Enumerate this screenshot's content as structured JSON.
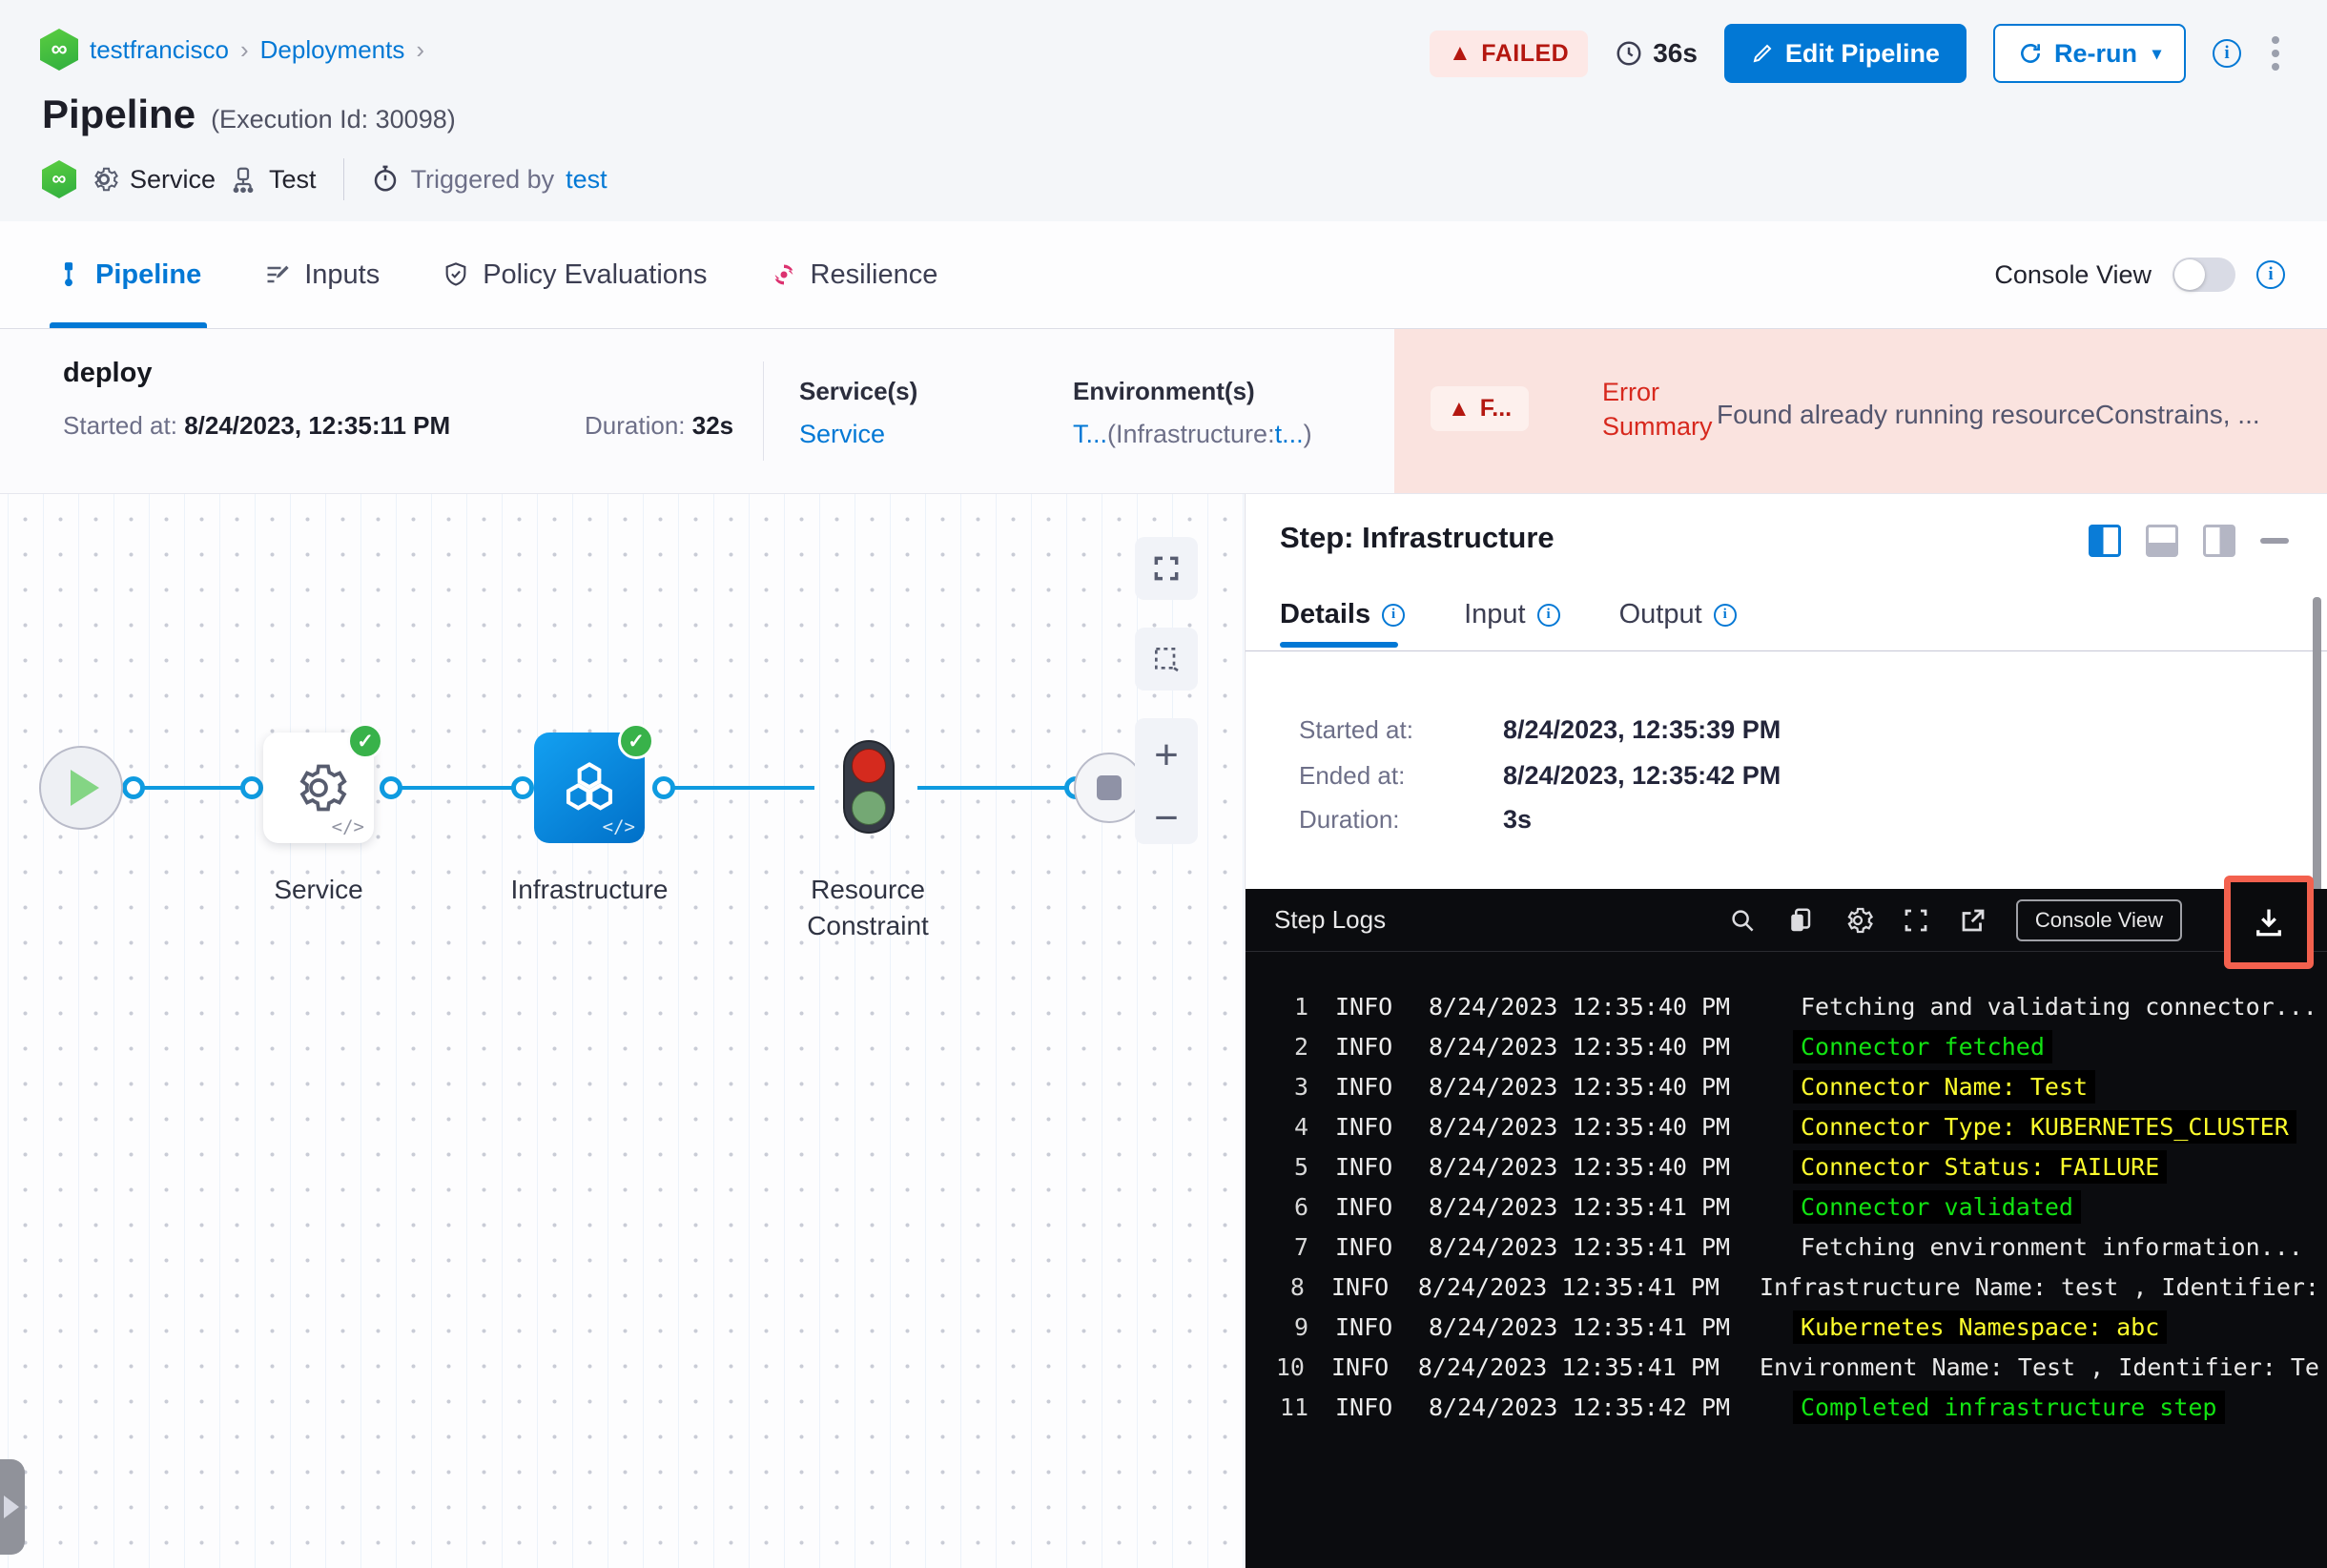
{
  "breadcrumb": {
    "project": "testfrancisco",
    "section": "Deployments",
    "separator": "›"
  },
  "page": {
    "title": "Pipeline",
    "execution_id": "(Execution Id: 30098)"
  },
  "actions": {
    "status_badge": "FAILED",
    "elapsed": "36s",
    "edit_button": "Edit Pipeline",
    "rerun_button": "Re-run",
    "caret": "▾"
  },
  "meta": {
    "service": "Service",
    "test": "Test",
    "triggered_by_label": "Triggered by",
    "triggered_by_value": "test"
  },
  "tabs": {
    "pipeline": "Pipeline",
    "inputs": "Inputs",
    "policy": "Policy Evaluations",
    "resilience": "Resilience",
    "console_view_label": "Console View"
  },
  "stage": {
    "name": "deploy",
    "started_label": "Started at:",
    "started_value": "8/24/2023, 12:35:11 PM",
    "duration_label": "Duration:",
    "duration_value": "32s",
    "services_label": "Service(s)",
    "services_value": "Service",
    "environments_label": "Environment(s)",
    "env_part1": "T...",
    "env_part2": "(Infrastructure:",
    "env_part3": "t...",
    "env_part4": ")",
    "error_badge": "F...",
    "error_label": "Error Summary",
    "error_message": "Found already running resourceConstrains, ..."
  },
  "graph": {
    "service_label": "Service",
    "infrastructure_label": "Infrastructure",
    "resource_constraint_label": "Resource Constraint",
    "code_glyph": "</>"
  },
  "panel": {
    "title": "Step: Infrastructure",
    "tab_details": "Details",
    "tab_input": "Input",
    "tab_output": "Output",
    "details": {
      "started_label": "Started at:",
      "started_value": "8/24/2023, 12:35:39 PM",
      "ended_label": "Ended at:",
      "ended_value": "8/24/2023, 12:35:42 PM",
      "duration_label": "Duration:",
      "duration_value": "3s"
    }
  },
  "logs": {
    "title": "Step Logs",
    "console_view_button": "Console View",
    "lines": [
      {
        "num": "1",
        "level": "INFO",
        "time": "8/24/2023 12:35:40 PM",
        "msg": "Fetching and validating connector...",
        "type": "plain"
      },
      {
        "num": "2",
        "level": "INFO",
        "time": "8/24/2023 12:35:40 PM",
        "msg": "Connector fetched",
        "type": "success"
      },
      {
        "num": "3",
        "level": "INFO",
        "time": "8/24/2023 12:35:40 PM",
        "msg": "Connector Name: Test",
        "type": "warn"
      },
      {
        "num": "4",
        "level": "INFO",
        "time": "8/24/2023 12:35:40 PM",
        "msg": "Connector Type: KUBERNETES_CLUSTER",
        "type": "warn"
      },
      {
        "num": "5",
        "level": "INFO",
        "time": "8/24/2023 12:35:40 PM",
        "msg": "Connector Status: FAILURE",
        "type": "warn"
      },
      {
        "num": "6",
        "level": "INFO",
        "time": "8/24/2023 12:35:41 PM",
        "msg": "Connector validated",
        "type": "success"
      },
      {
        "num": "7",
        "level": "INFO",
        "time": "8/24/2023 12:35:41 PM",
        "msg": "Fetching environment information...",
        "type": "plain"
      },
      {
        "num": "8",
        "level": "INFO",
        "time": "8/24/2023 12:35:41 PM",
        "msg": "Infrastructure Name: test , Identifier:",
        "type": "plain"
      },
      {
        "num": "9",
        "level": "INFO",
        "time": "8/24/2023 12:35:41 PM",
        "msg": "Kubernetes Namespace: abc",
        "type": "warn"
      },
      {
        "num": "10",
        "level": "INFO",
        "time": "8/24/2023 12:35:41 PM",
        "msg": "Environment Name: Test , Identifier: Te",
        "type": "plain"
      },
      {
        "num": "11",
        "level": "INFO",
        "time": "8/24/2023 12:35:42 PM",
        "msg": "Completed infrastructure step",
        "type": "success"
      }
    ]
  },
  "colors": {
    "accent_blue": "#0278d5",
    "failed_red": "#b41710",
    "error_bar_bg": "#fae3df",
    "log_green": "#12e312",
    "log_yellow": "#fdfd2c",
    "highlight_box": "#f3614e",
    "node_blue": "#0b84dd",
    "check_green": "#38b24a"
  }
}
